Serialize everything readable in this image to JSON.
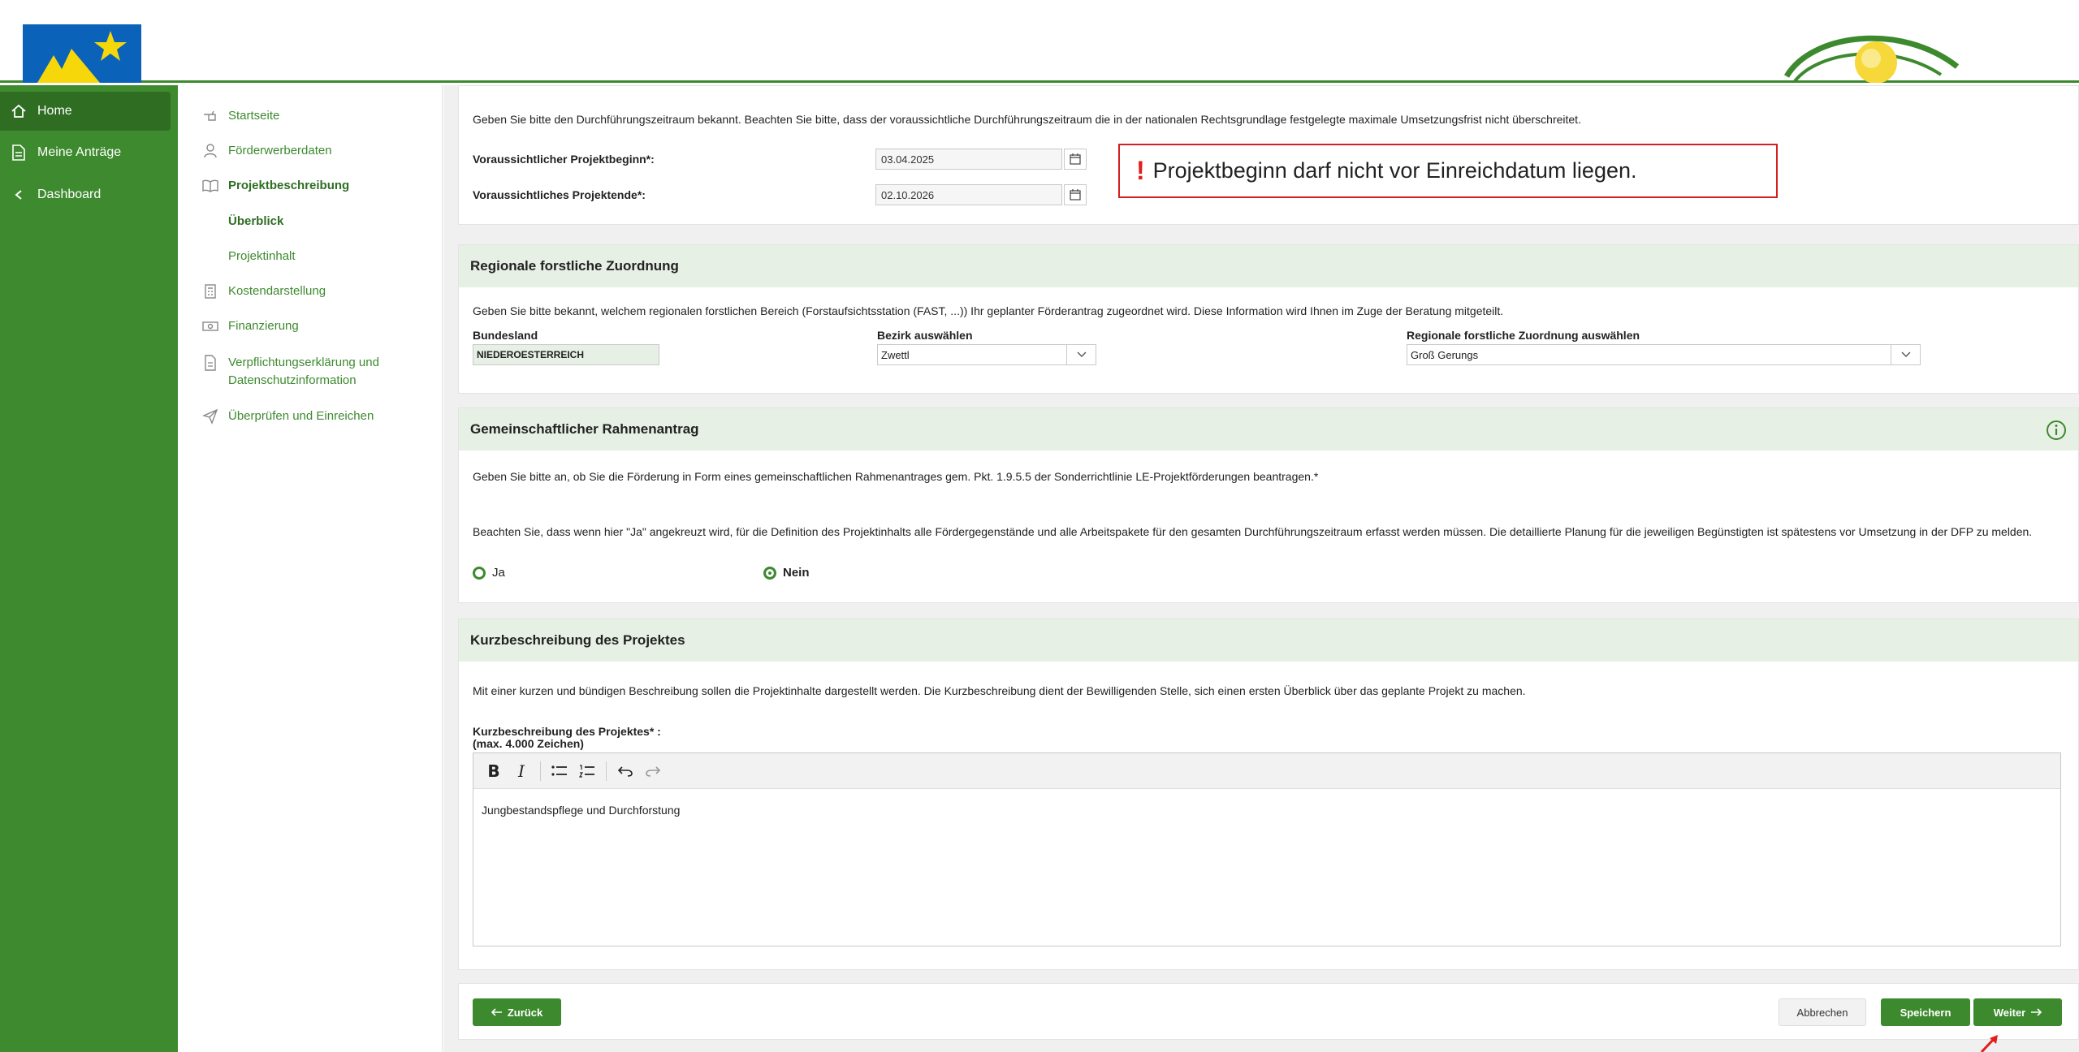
{
  "sidebar": {
    "items": [
      {
        "label": "Home",
        "icon": "home-icon"
      },
      {
        "label": "Meine Anträge",
        "icon": "document-icon"
      },
      {
        "label": "Dashboard",
        "icon": "chevron-left-icon"
      }
    ]
  },
  "subnav": {
    "items": [
      {
        "label": "Startseite"
      },
      {
        "label": "Förderwerberdaten"
      },
      {
        "label": "Projektbeschreibung"
      },
      {
        "label": "Überblick"
      },
      {
        "label": "Projektinhalt"
      },
      {
        "label": "Kostendarstellung"
      },
      {
        "label": "Finanzierung"
      },
      {
        "label": "Verpflichtungserklärung und Datenschutzinformation"
      },
      {
        "label": "Überprüfen und Einreichen"
      }
    ]
  },
  "period": {
    "intro": "Geben Sie bitte den Durchführungszeitraum bekannt. Beachten Sie bitte, dass der voraussichtliche Durchführungszeitraum die in der nationalen Rechtsgrundlage festgelegte maximale Umsetzungsfrist nicht überschreitet.",
    "start_label": "Voraussichtlicher Projektbeginn*:",
    "start_value": "03.04.2025",
    "end_label": "Voraussichtliches Projektende*:",
    "end_value": "02.10.2026",
    "error": "Projektbeginn darf nicht vor Einreichdatum liegen."
  },
  "regional": {
    "title": "Regionale forstliche Zuordnung",
    "intro": "Geben Sie bitte bekannt, welchem regionalen forstlichen Bereich (Forstaufsichtsstation (FAST, ...)) Ihr geplanter Förderantrag zugeordnet wird. Diese Information wird Ihnen im Zuge der Beratung mitgeteilt.",
    "bundesland_label": "Bundesland",
    "bundesland_value": "NIEDEROESTERREICH",
    "bezirk_label": "Bezirk auswählen",
    "bezirk_value": "Zwettl",
    "zuordnung_label": "Regionale forstliche Zuordnung auswählen",
    "zuordnung_value": "Groß Gerungs"
  },
  "rahmen": {
    "title": "Gemeinschaftlicher Rahmenantrag",
    "question": "Geben Sie bitte an, ob Sie die Förderung in Form eines gemeinschaftlichen Rahmenantrages gem. Pkt. 1.9.5.5 der Sonderrichtlinie LE-Projektförderungen beantragen.*",
    "note": "Beachten Sie, dass wenn hier \"Ja\" angekreuzt wird, für die Definition des Projektinhalts alle Fördergegenstände und alle Arbeitspakete für den gesamten Durchführungszeitraum erfasst werden müssen. Die detaillierte Planung für die jeweiligen Begünstigten ist spätestens vor Umsetzung in der DFP zu melden.",
    "option_yes": "Ja",
    "option_no": "Nein",
    "selected": "Nein"
  },
  "kurz": {
    "title": "Kurzbeschreibung des Projektes",
    "intro": "Mit einer kurzen und bündigen Beschreibung sollen die Projektinhalte dargestellt werden. Die Kurzbeschreibung dient der Bewilligenden Stelle, sich einen ersten Überblick über das geplante Projekt zu machen.",
    "field_label": "Kurzbeschreibung des Projektes* :",
    "field_hint": "(max. 4.000 Zeichen)",
    "value": "Jungbestandspflege und Durchforstung"
  },
  "footer": {
    "back": "Zurück",
    "cancel": "Abbrechen",
    "save": "Speichern",
    "next": "Weiter"
  },
  "colors": {
    "brand_green": "#3d8a2e",
    "section_header": "#e6f0e4",
    "error_red": "#d42020"
  }
}
